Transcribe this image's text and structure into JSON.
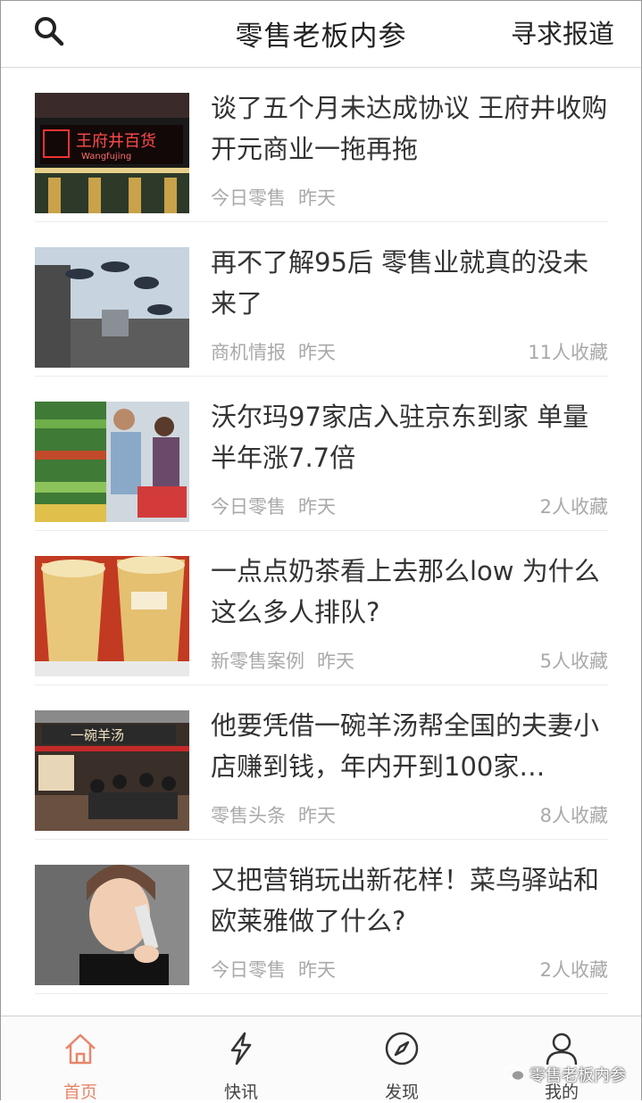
{
  "header": {
    "title": "零售老板内参",
    "right_action": "寻求报道",
    "search_icon": "search-icon"
  },
  "articles": [
    {
      "title": "谈了五个月未达成协议 王府井收购开元商业一拖再拖",
      "source": "今日零售",
      "time": "昨天",
      "favorites": "",
      "thumb_text": "王府井百货",
      "thumb_sub": "Wangfujing"
    },
    {
      "title": "再不了解95后 零售业就真的没未来了",
      "source": "商机情报",
      "time": "昨天",
      "favorites": "11人收藏"
    },
    {
      "title": "沃尔玛97家店入驻京东到家 单量半年涨7.7倍",
      "source": "今日零售",
      "time": "昨天",
      "favorites": "2人收藏"
    },
    {
      "title": "一点点奶茶看上去那么low 为什么这么多人排队?",
      "source": "新零售案例",
      "time": "昨天",
      "favorites": "5人收藏"
    },
    {
      "title": "他要凭借一碗羊汤帮全国的夫妻小店赚到钱，年内开到100家…",
      "source": "零售头条",
      "time": "昨天",
      "favorites": "8人收藏",
      "thumb_text": "一碗羊汤"
    },
    {
      "title": "又把营销玩出新花样！菜鸟驿站和欧莱雅做了什么?",
      "source": "今日零售",
      "time": "昨天",
      "favorites": "2人收藏"
    }
  ],
  "tabbar": {
    "tabs": [
      {
        "label": "首页",
        "icon": "home-icon",
        "active": true
      },
      {
        "label": "快讯",
        "icon": "lightning-icon",
        "active": false
      },
      {
        "label": "发现",
        "icon": "compass-icon",
        "active": false
      },
      {
        "label": "我的",
        "icon": "user-icon",
        "active": false
      }
    ]
  },
  "watermark": "零售老板内参",
  "colors": {
    "accent": "#e8866a",
    "text": "#333333",
    "meta": "#a9a9a9"
  }
}
